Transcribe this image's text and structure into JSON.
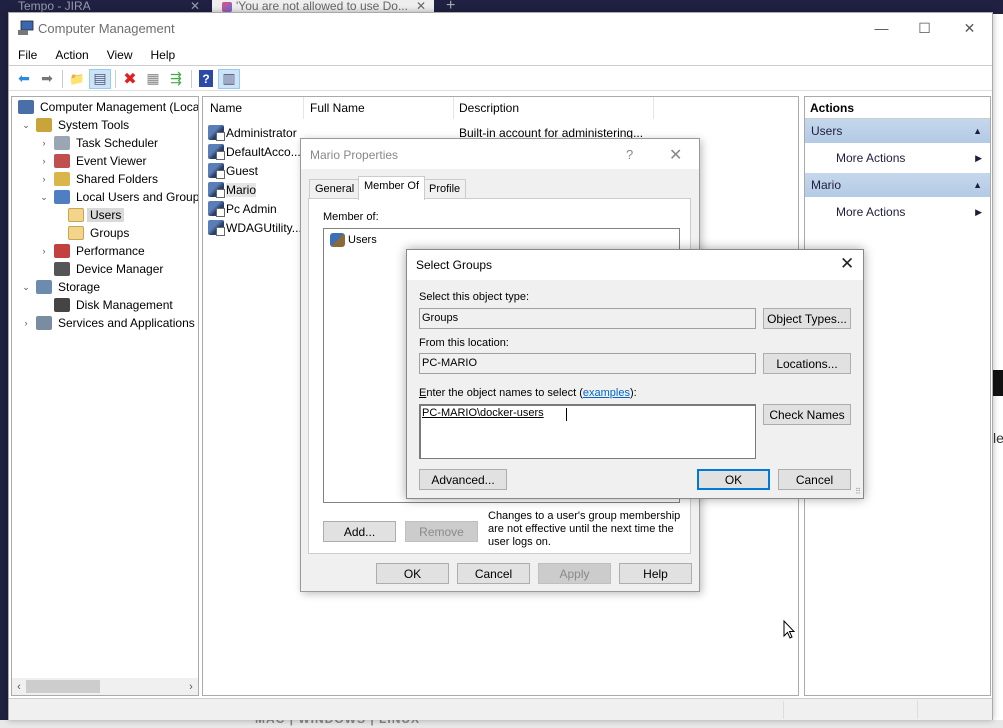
{
  "background": {
    "browser_tabs": [
      {
        "label": "Tempo - JIRA"
      },
      {
        "label": "'You are not allowed to use Do..."
      }
    ],
    "bottom_text": "MAC | WINDOWS | LINUX",
    "right_edge_text": "le"
  },
  "window": {
    "title": "Computer Management",
    "controls": {
      "minimize": "—",
      "maximize": "☐",
      "close": "✕"
    }
  },
  "menu": [
    "File",
    "Action",
    "View",
    "Help"
  ],
  "toolbar": [
    {
      "icon": "back-arrow-icon",
      "glyph": "⬅"
    },
    {
      "icon": "forward-arrow-icon",
      "glyph": "➡"
    },
    {
      "icon": "up-folder-icon",
      "glyph": "📁"
    },
    {
      "icon": "show-hide-console-tree-icon",
      "glyph": "▤"
    },
    {
      "icon": "delete-icon",
      "glyph": "✖"
    },
    {
      "icon": "properties-icon",
      "glyph": "▦"
    },
    {
      "icon": "export-list-icon",
      "glyph": "⇶"
    },
    {
      "icon": "help-icon",
      "glyph": "?"
    },
    {
      "icon": "show-hide-action-pane-icon",
      "glyph": "▥"
    }
  ],
  "tree": [
    {
      "label": "Computer Management (Local",
      "level": 0,
      "arrow": "",
      "icon": "computer-icon",
      "color": "#4a6ea8"
    },
    {
      "label": "System Tools",
      "level": 1,
      "arrow": "⌄",
      "icon": "tools-icon",
      "color": "#c9a43a"
    },
    {
      "label": "Task Scheduler",
      "level": 2,
      "arrow": "›",
      "icon": "clock-icon",
      "color": "#9aa6b4"
    },
    {
      "label": "Event Viewer",
      "level": 2,
      "arrow": "›",
      "icon": "event-viewer-icon",
      "color": "#c05050"
    },
    {
      "label": "Shared Folders",
      "level": 2,
      "arrow": "›",
      "icon": "shared-folder-icon",
      "color": "#d9b54a"
    },
    {
      "label": "Local Users and Groups",
      "level": 2,
      "arrow": "⌄",
      "icon": "users-groups-icon",
      "color": "#4f7fc2"
    },
    {
      "label": "Users",
      "level": 3,
      "arrow": "",
      "icon": "folder-icon",
      "color": "#f2d48a",
      "selected": true
    },
    {
      "label": "Groups",
      "level": 3,
      "arrow": "",
      "icon": "folder-icon",
      "color": "#f2d48a"
    },
    {
      "label": "Performance",
      "level": 2,
      "arrow": "›",
      "icon": "performance-icon",
      "color": "#c24040"
    },
    {
      "label": "Device Manager",
      "level": 2,
      "arrow": "",
      "icon": "device-manager-icon",
      "color": "#555555"
    },
    {
      "label": "Storage",
      "level": 1,
      "arrow": "⌄",
      "icon": "storage-icon",
      "color": "#6b8cae"
    },
    {
      "label": "Disk Management",
      "level": 2,
      "arrow": "",
      "icon": "disk-icon",
      "color": "#444444"
    },
    {
      "label": "Services and Applications",
      "level": 1,
      "arrow": "›",
      "icon": "services-icon",
      "color": "#7a8da0"
    }
  ],
  "list": {
    "columns": [
      "Name",
      "Full Name",
      "Description"
    ],
    "rows": [
      {
        "name": "Administrator",
        "full_name": "",
        "description": "Built-in account for administering..."
      },
      {
        "name": "DefaultAcco...",
        "full_name": "",
        "description": ""
      },
      {
        "name": "Guest",
        "full_name": "",
        "description": ""
      },
      {
        "name": "Mario",
        "full_name": "",
        "description": "",
        "selected": true
      },
      {
        "name": "Pc Admin",
        "full_name": "",
        "description": ""
      },
      {
        "name": "WDAGUtility...",
        "full_name": "",
        "description": ""
      }
    ]
  },
  "actions": {
    "title": "Actions",
    "sections": [
      {
        "label": "Users",
        "items": [
          "More Actions"
        ]
      },
      {
        "label": "Mario",
        "items": [
          "More Actions"
        ]
      }
    ]
  },
  "properties_dialog": {
    "title": "Mario Properties",
    "help": "?",
    "close": "✕",
    "tabs": [
      "General",
      "Member Of",
      "Profile"
    ],
    "active_tab": "Member Of",
    "member_of_label": "Member of:",
    "members": [
      "Users"
    ],
    "add_button": "Add...",
    "remove_button": "Remove",
    "note": "Changes to a user's group membership are not effective until the next time the user logs on.",
    "ok": "OK",
    "cancel": "Cancel",
    "apply": "Apply",
    "help_button": "Help"
  },
  "select_groups": {
    "title": "Select Groups",
    "close": "✕",
    "object_type_label": "Select this object type:",
    "object_type_value": "Groups",
    "object_types_button": "Object Types...",
    "location_label": "From this location:",
    "location_value": "PC-MARIO",
    "locations_button": "Locations...",
    "names_label_first": "E",
    "names_label_rest": "nter the object names to select (",
    "names_label_link": "examples",
    "names_label_end": "):",
    "names_value": "PC-MARIO\\docker-users",
    "check_names_button": "Check Names",
    "advanced_button": "Advanced...",
    "ok": "OK",
    "cancel": "Cancel"
  }
}
